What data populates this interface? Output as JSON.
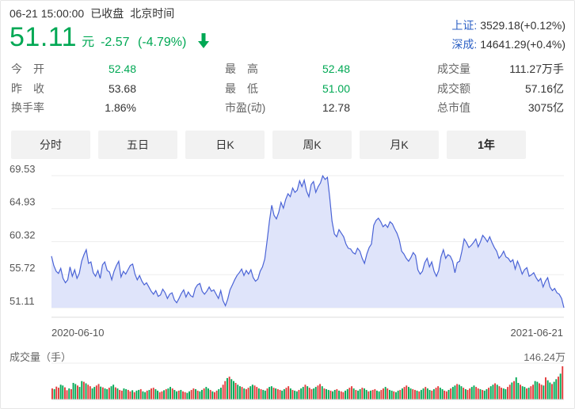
{
  "header": {
    "date_time": "06-21 15:00:00",
    "status": "已收盘",
    "timezone": "北京时间"
  },
  "quote": {
    "price": "51.11",
    "unit": "元",
    "change": "-2.57",
    "change_pct": "(-4.79%)",
    "direction_icon": "down-arrow-icon",
    "color_down": "#00a854",
    "color_up": "#e33b3b"
  },
  "indices": [
    {
      "name": "上证:",
      "value": "3529.18(+0.12%)"
    },
    {
      "name": "深成:",
      "value": "14641.29(+0.4%)"
    }
  ],
  "stats": {
    "col1": [
      {
        "label": "今　开",
        "value": "52.48",
        "tone": "green"
      },
      {
        "label": "昨　收",
        "value": "53.68",
        "tone": "plain"
      },
      {
        "label": "换手率",
        "value": "1.86%",
        "tone": "plain"
      }
    ],
    "col2": [
      {
        "label": "最　高",
        "value": "52.48",
        "tone": "green"
      },
      {
        "label": "最　低",
        "value": "51.00",
        "tone": "green"
      },
      {
        "label": "市盈(动)",
        "value": "12.78",
        "tone": "plain"
      }
    ],
    "col3": [
      {
        "label": "成交量",
        "value": "111.27万手",
        "tone": "plain"
      },
      {
        "label": "成交额",
        "value": "57.16亿",
        "tone": "plain"
      },
      {
        "label": "总市值",
        "value": "3075亿",
        "tone": "plain"
      }
    ]
  },
  "tabs": [
    {
      "label": "分时",
      "active": false
    },
    {
      "label": "五日",
      "active": false
    },
    {
      "label": "日K",
      "active": false
    },
    {
      "label": "周K",
      "active": false
    },
    {
      "label": "月K",
      "active": false
    },
    {
      "label": "1年",
      "active": true
    }
  ],
  "chart_data": {
    "type": "line",
    "y_ticks": [
      "69.53",
      "64.93",
      "60.32",
      "55.72",
      "51.11"
    ],
    "ylim": [
      51.11,
      69.53
    ],
    "x_start_label": "2020-06-10",
    "x_end_label": "2021-06-21",
    "line_color": "#4a63d6",
    "fill_color": "#dfe4fa",
    "series": [
      {
        "values": [
          58.3,
          57.0,
          56.2,
          55.9,
          56.6,
          55.2,
          54.6,
          55.0,
          56.8,
          55.5,
          56.4,
          55.2,
          55.9,
          57.6,
          58.5,
          59.2,
          57.3,
          57.5,
          56.0,
          55.5,
          56.3,
          55.2,
          57.1,
          57.5,
          56.3,
          56.1,
          55.0,
          56.2,
          57.0,
          57.6,
          55.4,
          56.2,
          55.8,
          56.4,
          57.0,
          57.2,
          55.8,
          55.0,
          55.6,
          54.8,
          54.3,
          54.6,
          54.0,
          53.4,
          53.0,
          53.5,
          52.7,
          52.9,
          53.7,
          53.2,
          52.4,
          53.0,
          53.2,
          52.2,
          51.8,
          52.4,
          53.1,
          53.6,
          52.6,
          53.3,
          52.8,
          52.6,
          53.8,
          54.3,
          54.5,
          53.4,
          53.0,
          53.4,
          54.0,
          53.4,
          53.6,
          53.0,
          52.4,
          53.5,
          52.1,
          51.4,
          52.3,
          53.6,
          54.3,
          55.0,
          55.6,
          56.0,
          56.5,
          55.6,
          56.3,
          55.8,
          56.4,
          55.3,
          54.8,
          55.1,
          56.2,
          56.8,
          57.9,
          60.5,
          63.2,
          65.4,
          64.0,
          63.5,
          64.4,
          65.8,
          65.0,
          66.2,
          67.0,
          66.6,
          67.8,
          67.2,
          67.5,
          68.8,
          68.0,
          68.9,
          67.4,
          66.6,
          68.3,
          68.7,
          67.2,
          68.0,
          68.5,
          69.5,
          69.0,
          69.3,
          66.5,
          63.2,
          61.4,
          61.0,
          62.0,
          61.5,
          61.0,
          60.0,
          59.4,
          59.3,
          58.8,
          58.6,
          59.4,
          59.0,
          58.0,
          57.3,
          58.6,
          59.5,
          60.0,
          62.6,
          63.3,
          63.6,
          63.1,
          62.4,
          62.7,
          62.3,
          63.1,
          62.8,
          62.1,
          61.5,
          60.6,
          59.0,
          58.6,
          58.0,
          57.6,
          58.1,
          58.8,
          58.4,
          56.4,
          55.8,
          56.2,
          57.4,
          58.0,
          56.8,
          57.5,
          56.2,
          55.5,
          56.3,
          58.2,
          59.2,
          58.0,
          58.5,
          58.3,
          57.6,
          56.0,
          57.4,
          57.6,
          59.0,
          60.7,
          60.2,
          59.5,
          59.8,
          60.2,
          60.7,
          59.6,
          60.3,
          61.2,
          60.8,
          60.3,
          61.0,
          60.2,
          59.5,
          59.0,
          58.0,
          58.4,
          59.0,
          58.2,
          58.0,
          57.5,
          57.8,
          56.5,
          57.6,
          56.8,
          55.8,
          56.4,
          56.7,
          55.5,
          55.7,
          56.0,
          55.3,
          54.8,
          55.2,
          54.0,
          54.8,
          55.3,
          54.0,
          53.5,
          53.8,
          53.2,
          53.0,
          52.4,
          51.11
        ]
      }
    ]
  },
  "volume": {
    "title": "成交量（手）",
    "max_label": "146.24万",
    "values": [
      30,
      28,
      35,
      32,
      40,
      38,
      33,
      25,
      30,
      28,
      45,
      42,
      38,
      34,
      50,
      48,
      44,
      40,
      36,
      30,
      34,
      38,
      42,
      35,
      33,
      30,
      28,
      32,
      36,
      40,
      33,
      30,
      26,
      24,
      30,
      28,
      26,
      22,
      25,
      20,
      24,
      26,
      28,
      22,
      20,
      24,
      26,
      30,
      32,
      28,
      24,
      20,
      22,
      25,
      28,
      30,
      34,
      30,
      26,
      22,
      24,
      26,
      22,
      20,
      18,
      22,
      26,
      30,
      28,
      24,
      22,
      26,
      30,
      34,
      30,
      26,
      22,
      20,
      24,
      28,
      32,
      40,
      50,
      58,
      62,
      55,
      50,
      45,
      40,
      36,
      34,
      30,
      28,
      32,
      36,
      40,
      38,
      34,
      30,
      28,
      26,
      24,
      30,
      34,
      36,
      32,
      30,
      28,
      26,
      24,
      28,
      32,
      36,
      30,
      26,
      24,
      22,
      26,
      30,
      34,
      40,
      36,
      32,
      28,
      30,
      34,
      38,
      42,
      36,
      30,
      28,
      26,
      24,
      22,
      26,
      28,
      24,
      22,
      20,
      24,
      28,
      32,
      36,
      30,
      26,
      24,
      28,
      32,
      30,
      26,
      22,
      24,
      26,
      28,
      24,
      22,
      26,
      30,
      34,
      30,
      26,
      24,
      22,
      20,
      24,
      26,
      30,
      34,
      38,
      34,
      30,
      28,
      26,
      24,
      22,
      26,
      30,
      34,
      30,
      26,
      24,
      28,
      32,
      36,
      32,
      28,
      24,
      22,
      26,
      30,
      34,
      38,
      42,
      40,
      36,
      32,
      28,
      26,
      30,
      34,
      38,
      34,
      30,
      28,
      26,
      24,
      28,
      32,
      36,
      40,
      44,
      40,
      36,
      32,
      30,
      28,
      34,
      40,
      46,
      50,
      60,
      45,
      40,
      36,
      34,
      30,
      32,
      36,
      40,
      50,
      48,
      44,
      40,
      38,
      60,
      52,
      46,
      42,
      48,
      55,
      62,
      70,
      90
    ]
  }
}
